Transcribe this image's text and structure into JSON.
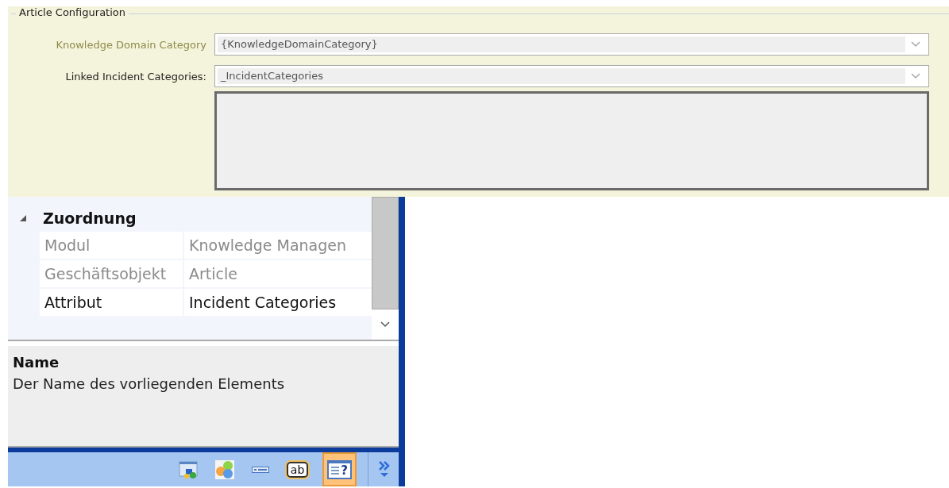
{
  "article_configuration": {
    "title": "Article Configuration",
    "fields": [
      {
        "label": "Knowledge Domain Category",
        "value": "{KnowledgeDomainCategory}",
        "disabled": true
      },
      {
        "label": "Linked Incident Categories:",
        "value": "_IncidentCategories",
        "disabled": false
      }
    ]
  },
  "property_grid": {
    "category": {
      "label": "Zuordnung",
      "expanded": true,
      "rows": [
        {
          "name": "Modul",
          "value": "Knowledge Managen",
          "disabled": true
        },
        {
          "name": "Geschäftsobjekt",
          "value": "Article",
          "disabled": true
        },
        {
          "name": "Attribut",
          "value": "Incident Categories",
          "disabled": false
        }
      ]
    }
  },
  "description": {
    "title": "Name",
    "text": "Der Name des vorliegenden Elements"
  },
  "toolbar": [
    {
      "kind": "window",
      "selected": false
    },
    {
      "kind": "circles",
      "selected": false
    },
    {
      "kind": "field",
      "selected": false
    },
    {
      "kind": "text",
      "glyph": "ab",
      "selected": false
    },
    {
      "kind": "help",
      "glyph": "?",
      "selected": true
    },
    {
      "kind": "more",
      "selected": false
    }
  ]
}
